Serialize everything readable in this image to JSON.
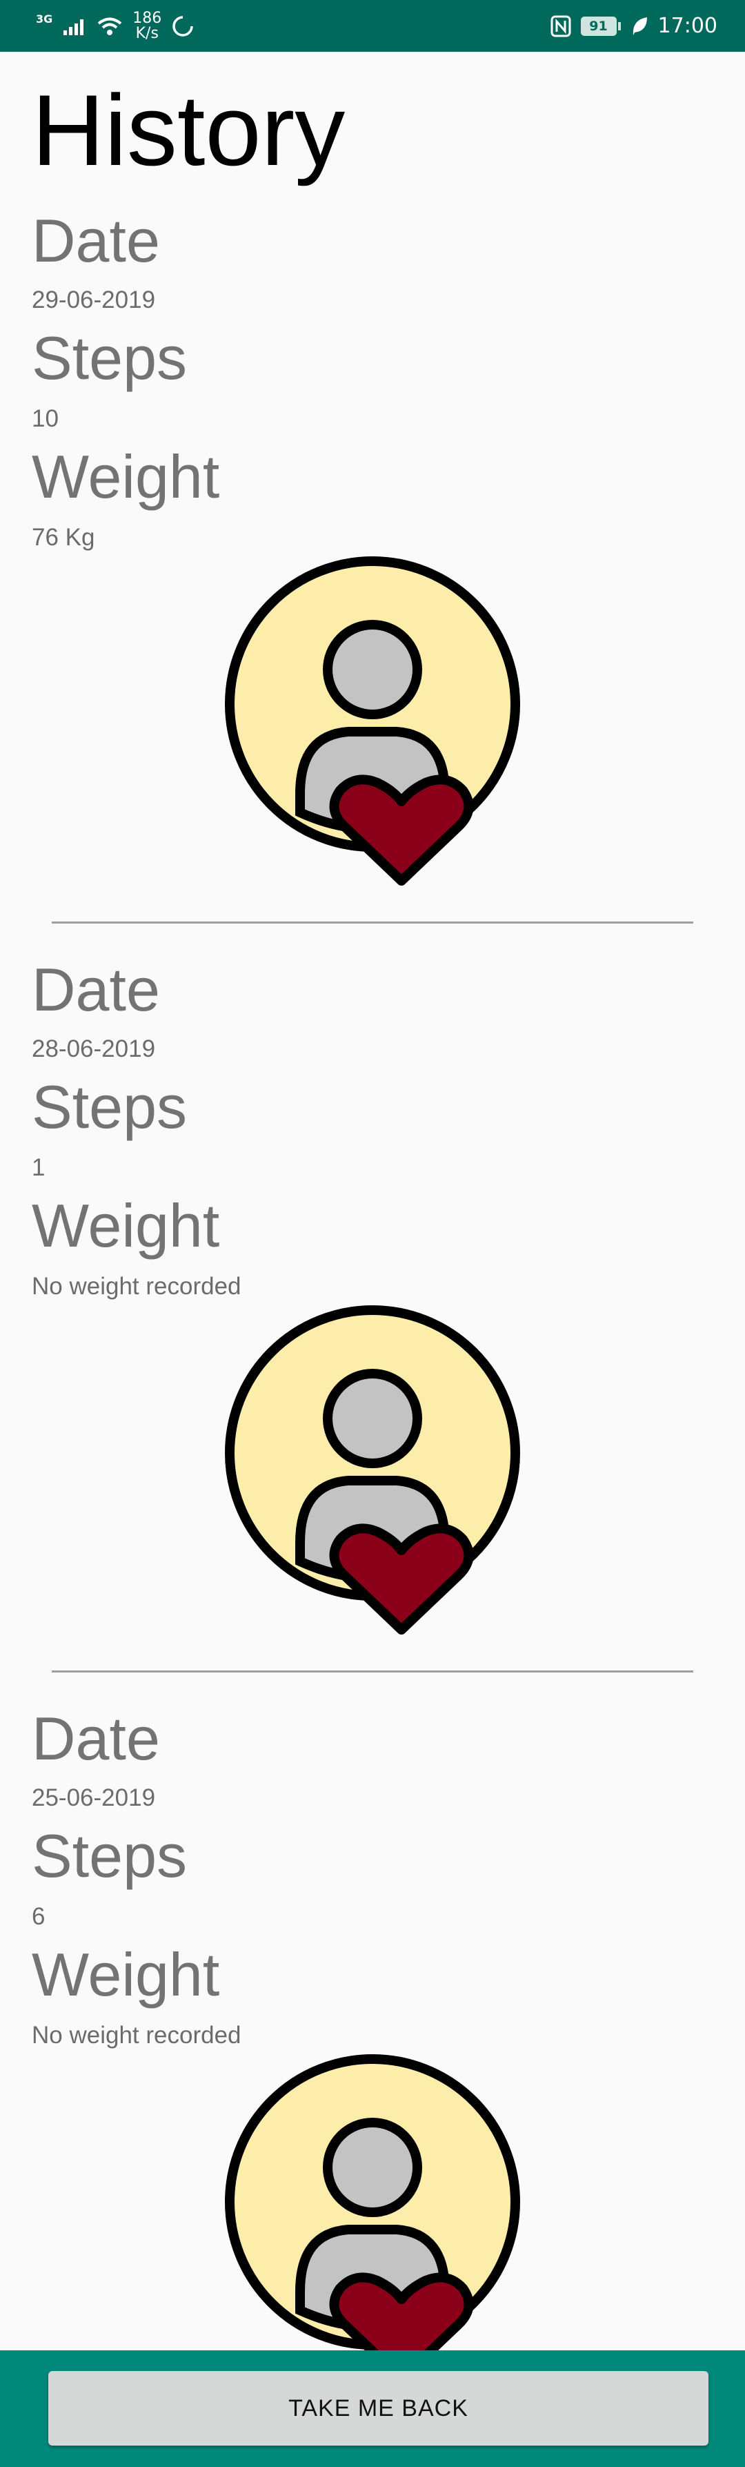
{
  "status_bar": {
    "network_type": "3G",
    "speed_value": "186",
    "speed_unit": "K/s",
    "battery": "91",
    "time": "17:00"
  },
  "page": {
    "title": "History"
  },
  "labels": {
    "date": "Date",
    "steps": "Steps",
    "weight": "Weight"
  },
  "entries": [
    {
      "date": "29-06-2019",
      "steps": "10",
      "weight": "76 Kg"
    },
    {
      "date": "28-06-2019",
      "steps": "1",
      "weight": "No weight recorded"
    },
    {
      "date": "25-06-2019",
      "steps": "6",
      "weight": "No weight recorded"
    }
  ],
  "footer": {
    "back_label": "TAKE ME BACK"
  },
  "colors": {
    "status_bar": "#00695c",
    "bottom_bar": "#00897b",
    "emblem_circle": "#fdedab",
    "emblem_person": "#c3c3c3",
    "emblem_heart": "#8b0018"
  },
  "icons": {
    "entry_emblem": "person-heart-icon"
  }
}
